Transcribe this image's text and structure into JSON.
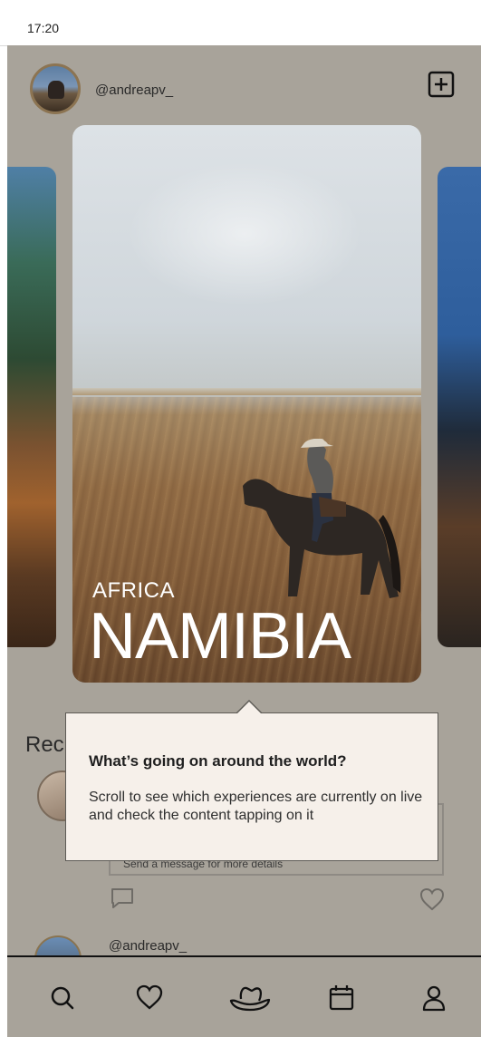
{
  "status_bar": {
    "time": "17:20"
  },
  "header": {
    "username": "@andreapv_",
    "add_icon": "plus-square-icon"
  },
  "carousel": {
    "main_card": {
      "region": "AFRICA",
      "destination": "NAMIBIA"
    }
  },
  "background_section": {
    "heading": "Rec",
    "message_placeholder": "Send a message for more details",
    "post_username": "@andreapv_"
  },
  "tooltip": {
    "title": "What’s going on around the world?",
    "body": "Scroll to see which experiences are currently on live and check the content tapping on it"
  },
  "bottom_nav": {
    "items": [
      {
        "icon": "search-icon"
      },
      {
        "icon": "heart-icon"
      },
      {
        "icon": "cowboy-hat-icon"
      },
      {
        "icon": "calendar-icon"
      },
      {
        "icon": "profile-icon"
      }
    ]
  }
}
